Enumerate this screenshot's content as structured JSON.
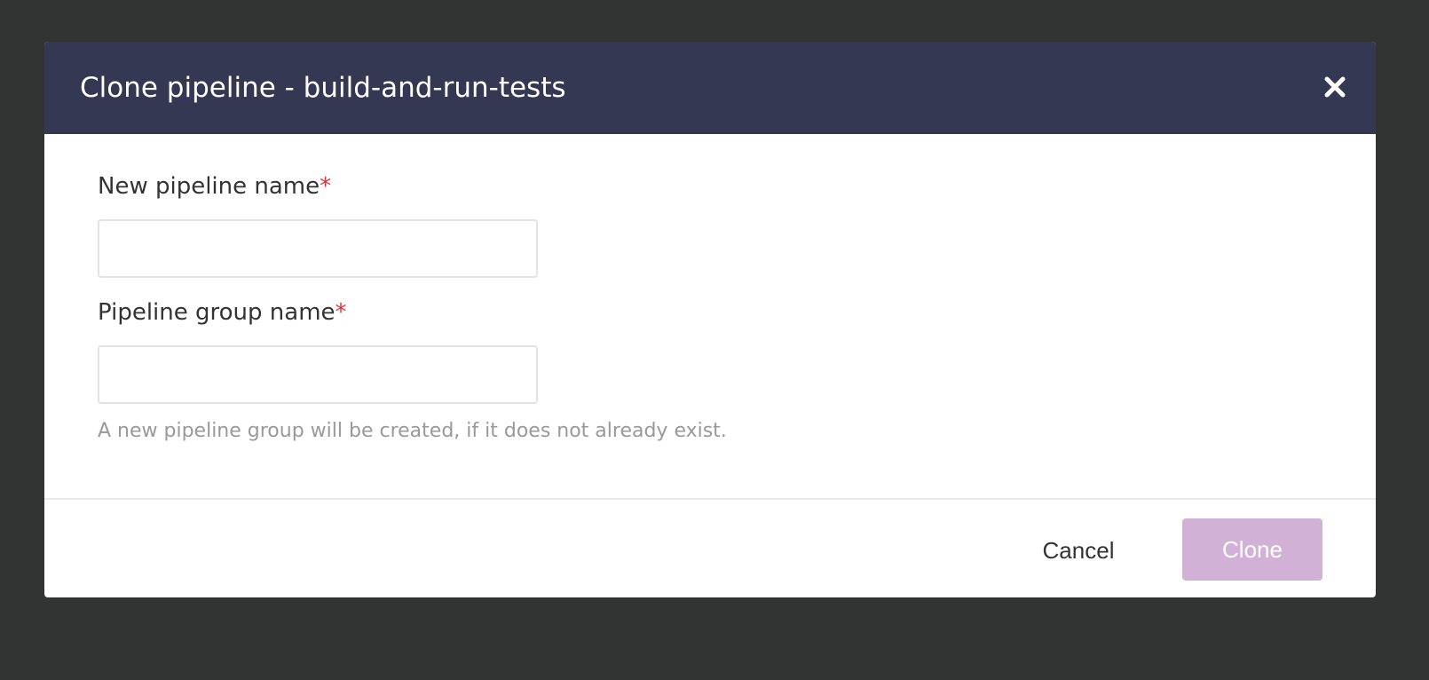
{
  "modal": {
    "title": "Clone pipeline - build-and-run-tests",
    "close_icon": "close-icon"
  },
  "form": {
    "pipeline_name": {
      "label": "New pipeline name",
      "required_marker": "*",
      "value": "",
      "placeholder": ""
    },
    "group_name": {
      "label": "Pipeline group name",
      "required_marker": "*",
      "value": "",
      "placeholder": ""
    },
    "help_text": "A new pipeline group will be created, if it does not already exist."
  },
  "footer": {
    "cancel_label": "Cancel",
    "clone_label": "Clone"
  },
  "colors": {
    "overlay": "#323433",
    "header": "#343852",
    "required": "#e0323a",
    "clone_disabled": "#d1b1d6"
  }
}
